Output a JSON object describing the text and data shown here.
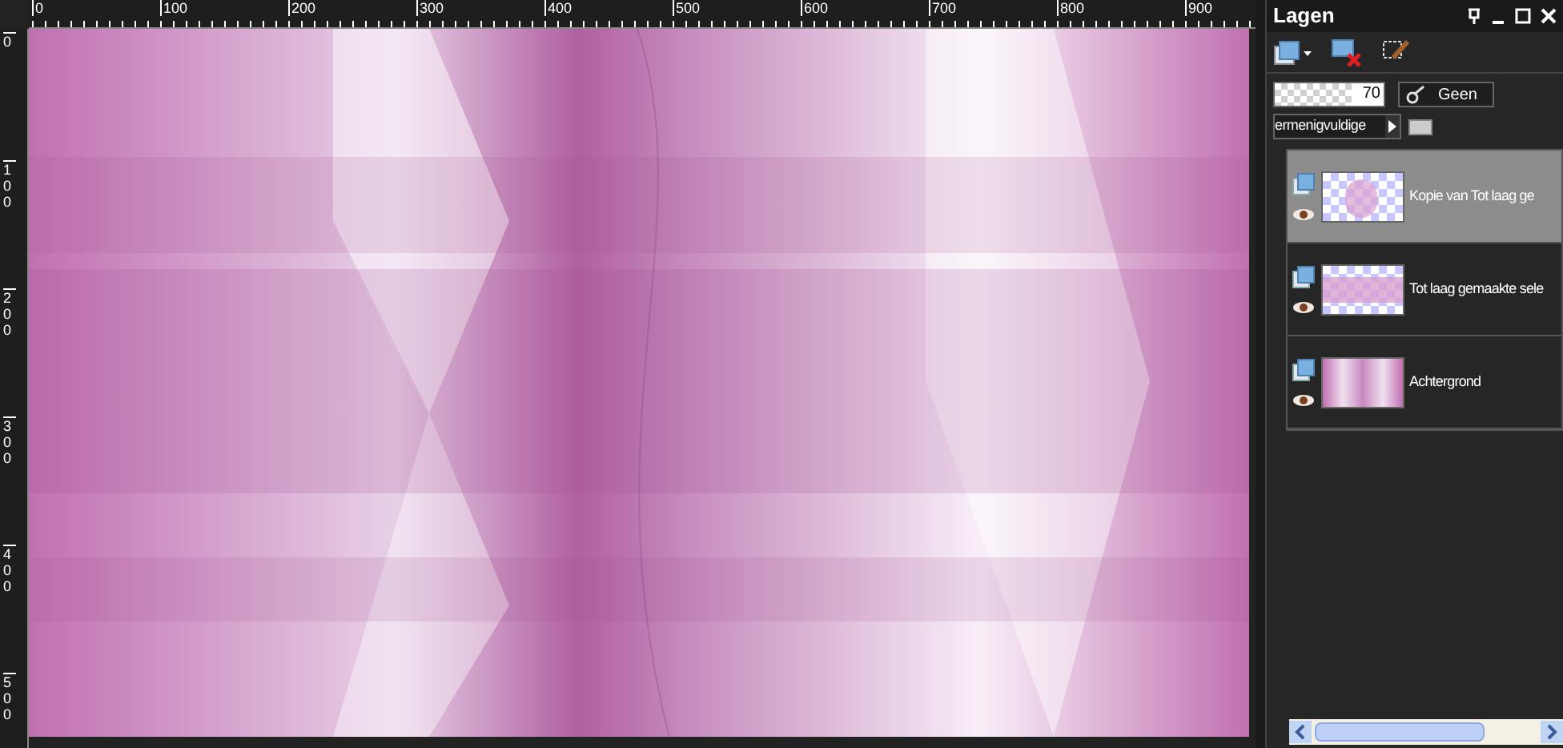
{
  "rulers": {
    "horizontal": [
      "0",
      "100",
      "200",
      "300",
      "400",
      "500",
      "600",
      "700",
      "800",
      "900"
    ],
    "vertical": [
      "0",
      "100",
      "200",
      "300",
      "400",
      "500"
    ]
  },
  "layers_panel": {
    "title": "Lagen",
    "opacity": {
      "level": 0.7,
      "reading": "70"
    },
    "mask_button": "Geen",
    "blend_mode": "ermenigvuldige",
    "layers": [
      {
        "name": "Kopie van Tot laag ge",
        "selected": true,
        "visible": true,
        "kind": "blur"
      },
      {
        "name": "Tot laag gemaakte sele",
        "selected": false,
        "visible": true,
        "kind": "band"
      },
      {
        "name": "Achtergrond",
        "selected": false,
        "visible": true,
        "kind": "full"
      }
    ]
  }
}
